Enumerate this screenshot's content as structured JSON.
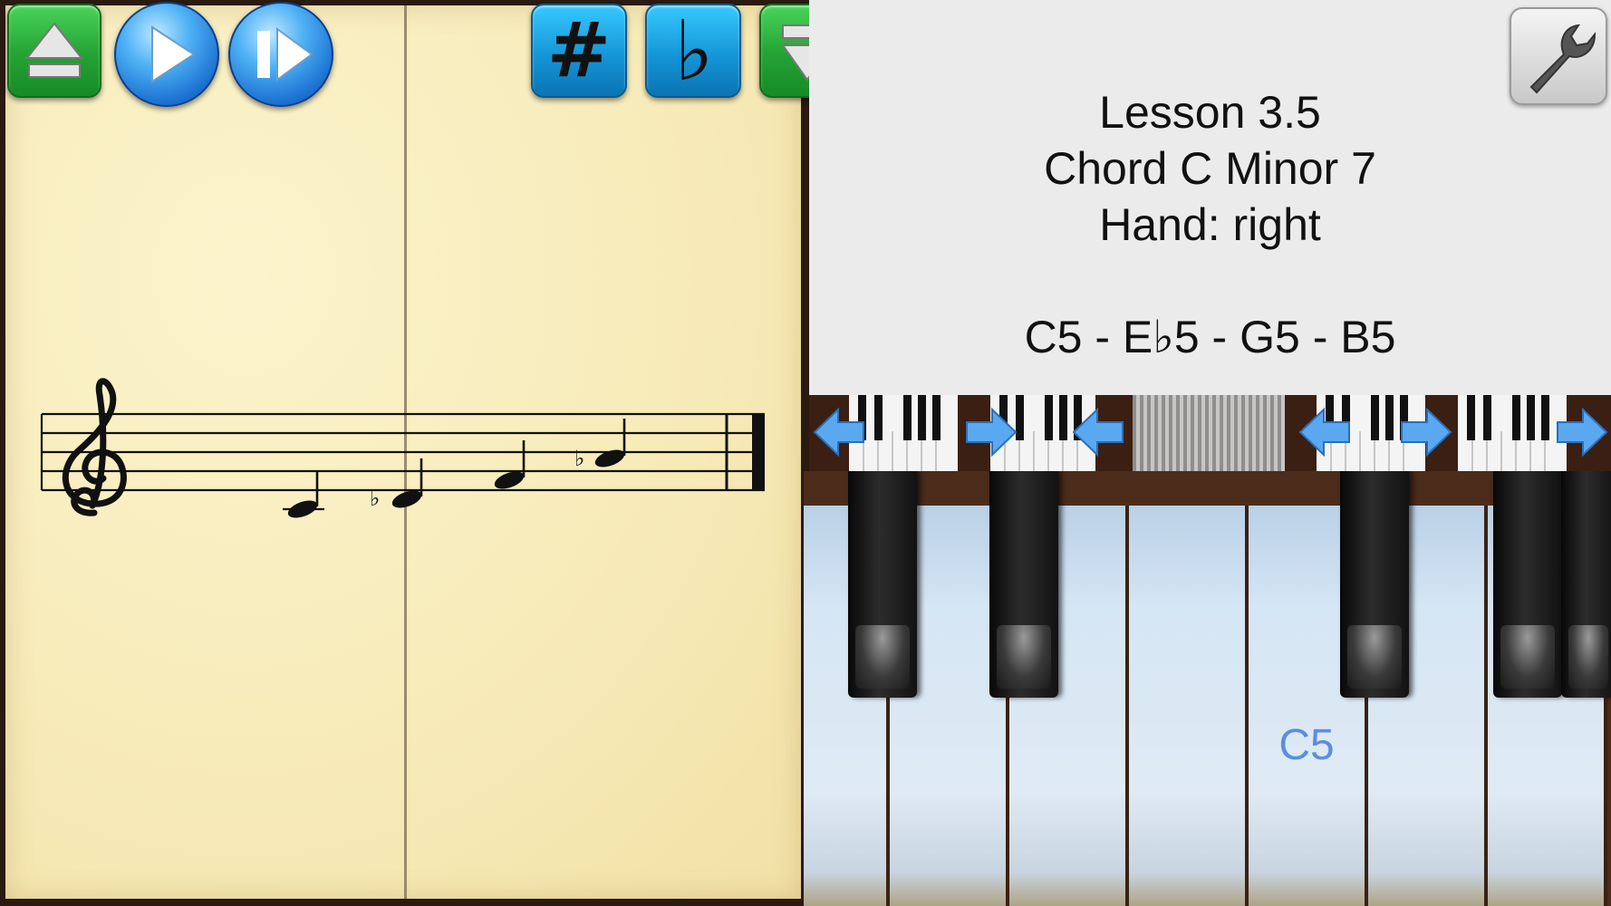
{
  "lesson": {
    "title": "Lesson 3.5",
    "chord": "Chord C Minor 7",
    "hand": "Hand: right",
    "notes": "C5 - E♭5 - G5 - B5"
  },
  "toolbar": {
    "buttons": [
      {
        "name": "scroll-up-button",
        "icon": "eject-up-icon"
      },
      {
        "name": "play-button",
        "icon": "play-icon"
      },
      {
        "name": "step-play-button",
        "icon": "step-play-icon"
      },
      {
        "name": "sharp-button",
        "icon": "sharp-icon",
        "glyph": "#"
      },
      {
        "name": "flat-button",
        "icon": "flat-icon",
        "glyph": "♭"
      },
      {
        "name": "scroll-down-button",
        "icon": "eject-down-icon"
      },
      {
        "name": "view-toggle-button",
        "icon": "sheet-piano-thumbnail-icon"
      },
      {
        "name": "settings-button",
        "icon": "wrench-icon"
      }
    ]
  },
  "staff": {
    "clef": "treble-clef-icon",
    "accidental": "♭"
  },
  "piano": {
    "highlighted_key_label": "C5"
  },
  "colors": {
    "sheet": "#f7ebb9",
    "toolbar_green": "#26a637",
    "toolbar_teal": "#1596d8",
    "play_blue": "#1a6fd0",
    "info_panel": "#ebebeb",
    "key_label": "#5a8ee0",
    "nav_arrow": "#5aa8f0"
  }
}
